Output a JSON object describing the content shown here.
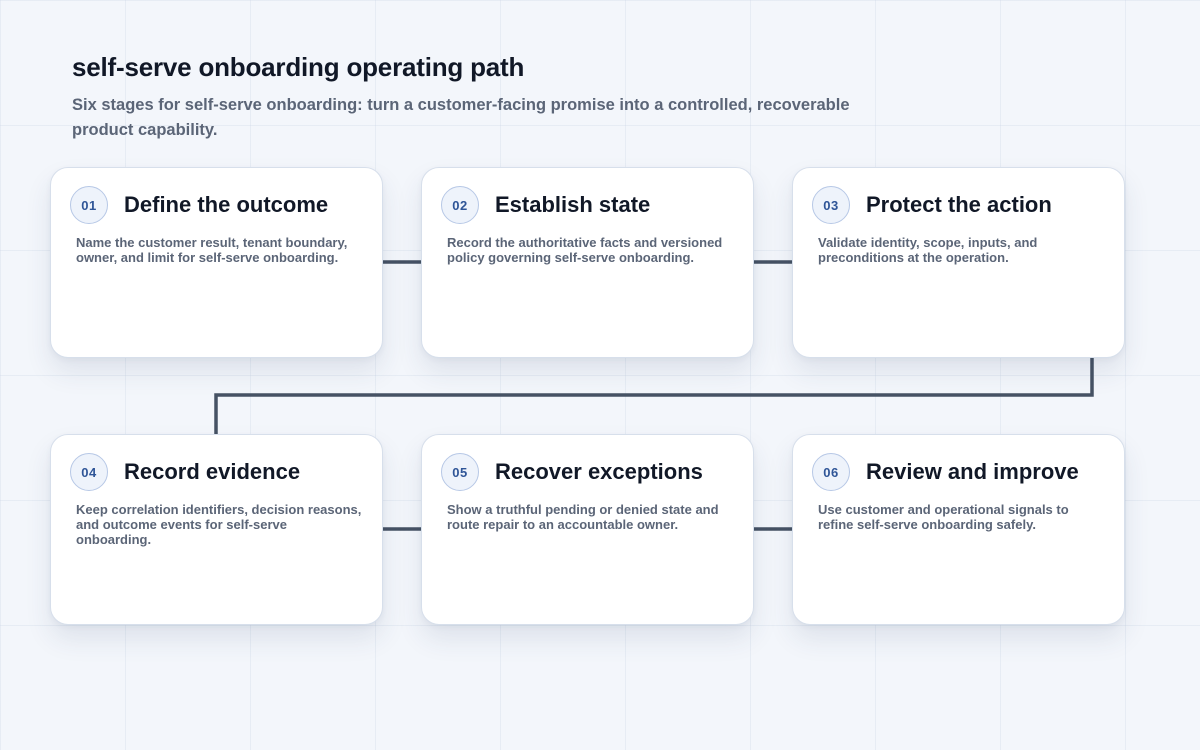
{
  "header": {
    "title": "self-serve onboarding operating path",
    "subtitle": "Six stages for self-serve onboarding: turn a customer-facing promise into a controlled, recoverable product capability."
  },
  "stages": [
    {
      "number": "01",
      "title": "Define the outcome",
      "description": "Name the customer result, tenant boundary, owner, and limit for self-serve onboarding."
    },
    {
      "number": "02",
      "title": "Establish state",
      "description": "Record the authoritative facts and versioned policy governing self-serve onboarding."
    },
    {
      "number": "03",
      "title": "Protect the action",
      "description": "Validate identity, scope, inputs, and preconditions at the operation."
    },
    {
      "number": "04",
      "title": "Record evidence",
      "description": "Keep correlation identifiers, decision reasons, and outcome events for self-serve onboarding."
    },
    {
      "number": "05",
      "title": "Recover exceptions",
      "description": "Show a truthful pending or denied state and route repair to an accountable owner."
    },
    {
      "number": "06",
      "title": "Review and improve",
      "description": "Use customer and operational signals to refine self-serve onboarding safely."
    }
  ],
  "colors": {
    "connector": "#465264",
    "badge_text": "#2f5597",
    "card_background": "#ffffff",
    "page_background": "#f3f6fb"
  }
}
